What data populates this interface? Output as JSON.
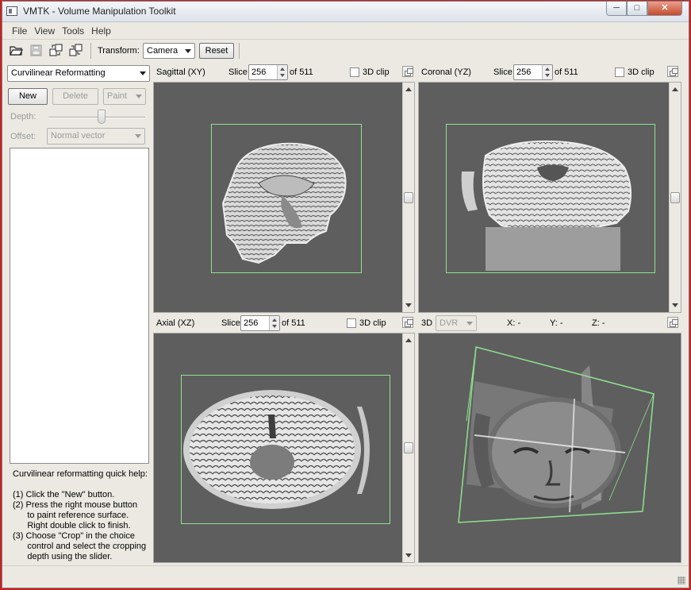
{
  "window": {
    "title": "VMTK - Volume Manipulation Toolkit"
  },
  "window_controls": {
    "minimize": "─",
    "maximize": "□",
    "close": "✕"
  },
  "menu": [
    "File",
    "View",
    "Tools",
    "Help"
  ],
  "toolbar": {
    "icons": [
      "open-folder-icon",
      "save-icon",
      "export-icon",
      "import-icon"
    ],
    "transform_label": "Transform:",
    "transform_value": "Camera",
    "reset_label": "Reset"
  },
  "left_panel": {
    "mode_value": "Curvilinear Reformatting",
    "new_label": "New",
    "delete_label": "Delete",
    "paint_label": "Paint",
    "depth_label": "Depth:",
    "depth_level": 0.55,
    "offset_label": "Offset:",
    "offset_value": "Normal vector",
    "help_title": "Curvilinear reformatting quick help:",
    "help_lines": [
      "(1) Click the \"New\" button.",
      "(2) Press the right mouse button",
      "      to paint reference surface.",
      "      Right double click to finish.",
      "(3) Choose \"Crop\" in the choice",
      "      control and select the cropping",
      "      depth using the slider."
    ]
  },
  "views": {
    "sagittal": {
      "title": "Sagittal (XY)",
      "slice_label": "Slice",
      "slice_value": "256",
      "of_label": "of 511",
      "clip_label": "3D clip"
    },
    "coronal": {
      "title": "Coronal (YZ)",
      "slice_label": "Slice",
      "slice_value": "256",
      "of_label": "of 511",
      "clip_label": "3D clip"
    },
    "axial": {
      "title": "Axial (XZ)",
      "slice_label": "Slice",
      "slice_value": "256",
      "of_label": "of 511",
      "clip_label": "3D clip"
    },
    "three_d": {
      "title": "3D",
      "render_value": "DVR",
      "x_label": "X: -",
      "y_label": "Y: -",
      "z_label": "Z: -"
    }
  },
  "colors": {
    "viewport_bg": "#5e5e5e",
    "crop_box": "#8ee28e",
    "window_bg": "#ece9e3"
  }
}
